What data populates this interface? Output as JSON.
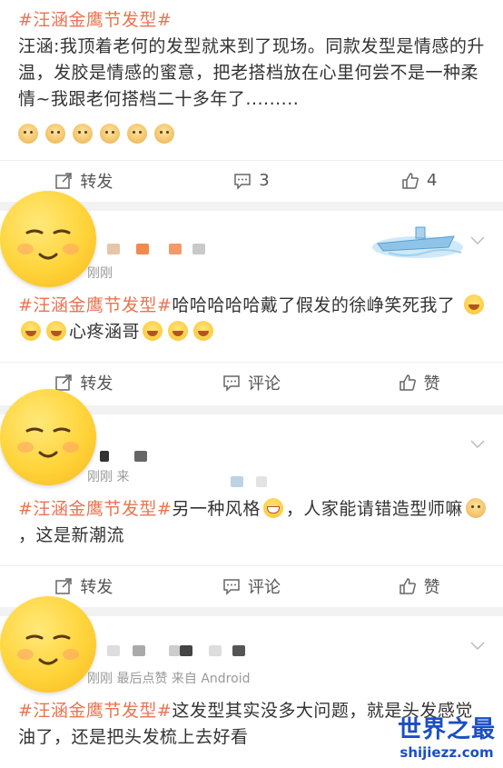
{
  "posts": [
    {
      "topic": "#汪涵金鹰节发型#",
      "body": "汪涵:我顶着老何的发型就来到了现场。同款发型是情感的升温，发胶是情感的蜜意，把老搭档放在心里何尝不是一种柔情~我跟老何搭档二十多年了.........",
      "actions": {
        "repost": "转发",
        "comment": "3",
        "like": "4"
      }
    },
    {
      "time": "刚刚",
      "topic": "#汪涵金鹰节发型#",
      "body_a": "哈哈哈哈哈戴了假发的徐峥笑死我了",
      "body_b": "心疼涵哥",
      "actions": {
        "repost": "转发",
        "comment": "评论",
        "like": "赞"
      }
    },
    {
      "time": "刚刚  来",
      "topic": "#汪涵金鹰节发型#",
      "body_a": "另一种风格",
      "body_b": "，人家能请错造型师嘛",
      "body_c": "，这是新潮流",
      "actions": {
        "repost": "转发",
        "comment": "评论",
        "like": "赞"
      }
    },
    {
      "time": "刚刚  最后点赞  来自 Android",
      "topic": "#汪涵金鹰节发型#",
      "body": "这发型其实没多大问题，就是头发感觉油了，还是把头发梳上去好看"
    }
  ],
  "watermark": {
    "line1": "世界之最",
    "line2": "shijiezz.com"
  },
  "colors": {
    "topic": "#eb7350",
    "watermark": "#1a4fc4"
  }
}
